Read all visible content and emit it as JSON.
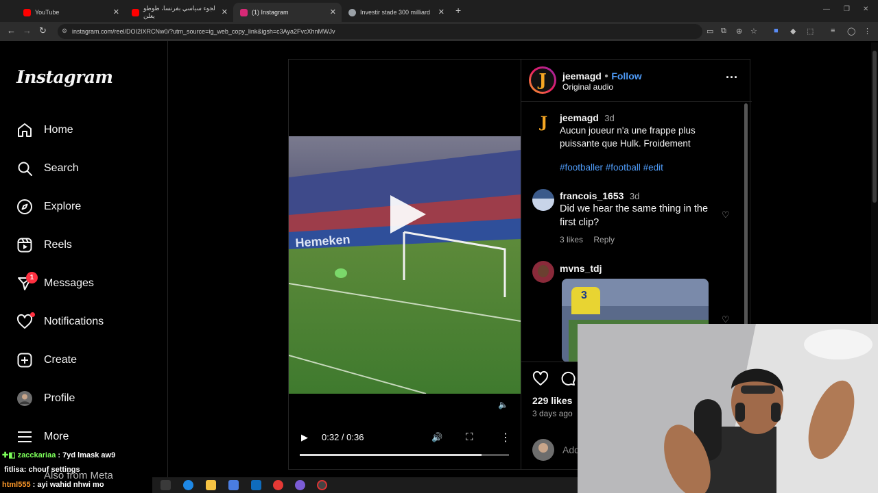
{
  "browser": {
    "tabs": [
      {
        "title": "YouTube",
        "favicon": "youtube-icon",
        "color": "#ff0000"
      },
      {
        "title": "لجوء سياسي بفرنسا، طوطو يعلن",
        "favicon": "youtube-icon",
        "color": "#ff0000"
      },
      {
        "title": "(1) Instagram",
        "favicon": "instagram-icon",
        "color": "#d62976",
        "active": true
      },
      {
        "title": "Investir stade 300 milliard",
        "favicon": "globe-icon",
        "color": "#9aa0a6"
      }
    ],
    "url": "instagram.com/reel/DOI2IXRCNw0/?utm_source=ig_web_copy_link&igsh=c3Aya2FvcXhnMWJv"
  },
  "sidebar": {
    "logo": "Instagram",
    "items": [
      {
        "label": "Home",
        "icon": "home-icon"
      },
      {
        "label": "Search",
        "icon": "search-icon"
      },
      {
        "label": "Explore",
        "icon": "compass-icon"
      },
      {
        "label": "Reels",
        "icon": "reels-icon"
      },
      {
        "label": "Messages",
        "icon": "messenger-icon",
        "badge": "1"
      },
      {
        "label": "Notifications",
        "icon": "heart-icon"
      },
      {
        "label": "Create",
        "icon": "plus-square-icon"
      },
      {
        "label": "Profile",
        "icon": "avatar"
      },
      {
        "label": "More",
        "icon": "menu-icon"
      }
    ],
    "footer_partial": "Also from Meta"
  },
  "post": {
    "author": "jeemagd",
    "follow_label": "Follow",
    "audio": "Original audio",
    "video": {
      "current": "0:32",
      "total": "0:36",
      "time_display": "0:32 / 0:36",
      "progress": 0.87
    },
    "caption": {
      "user": "jeemagd",
      "time": "3d",
      "text": "Aucun joueur n'a une frappe plus puissante que Hulk. Froidement",
      "hashtags": "#footballer #football #edit"
    },
    "comments": [
      {
        "user": "francois_1653",
        "time": "3d",
        "text": "Did we hear the same thing in the first clip?",
        "likes": "3 likes",
        "reply": "Reply"
      },
      {
        "user": "mvns_tdj",
        "time": "",
        "text": "",
        "likes": "",
        "reply": ""
      }
    ],
    "likes": "229 likes",
    "posted": "3 days ago",
    "add_comment_placeholder": "Add"
  },
  "chat": [
    {
      "user": "zacckariaa",
      "text": "7yd lmask aw9",
      "color": "#7cff5a"
    },
    {
      "user": "fitlisa",
      "text": "chouf settings",
      "color": "#ffffff"
    },
    {
      "user": "html555",
      "text": "ayi wahid nhwi mo",
      "color": "#ff9a2a"
    }
  ],
  "colors": {
    "accent": "#4f9cf9",
    "badge": "#ff3040",
    "bg": "#000000"
  }
}
